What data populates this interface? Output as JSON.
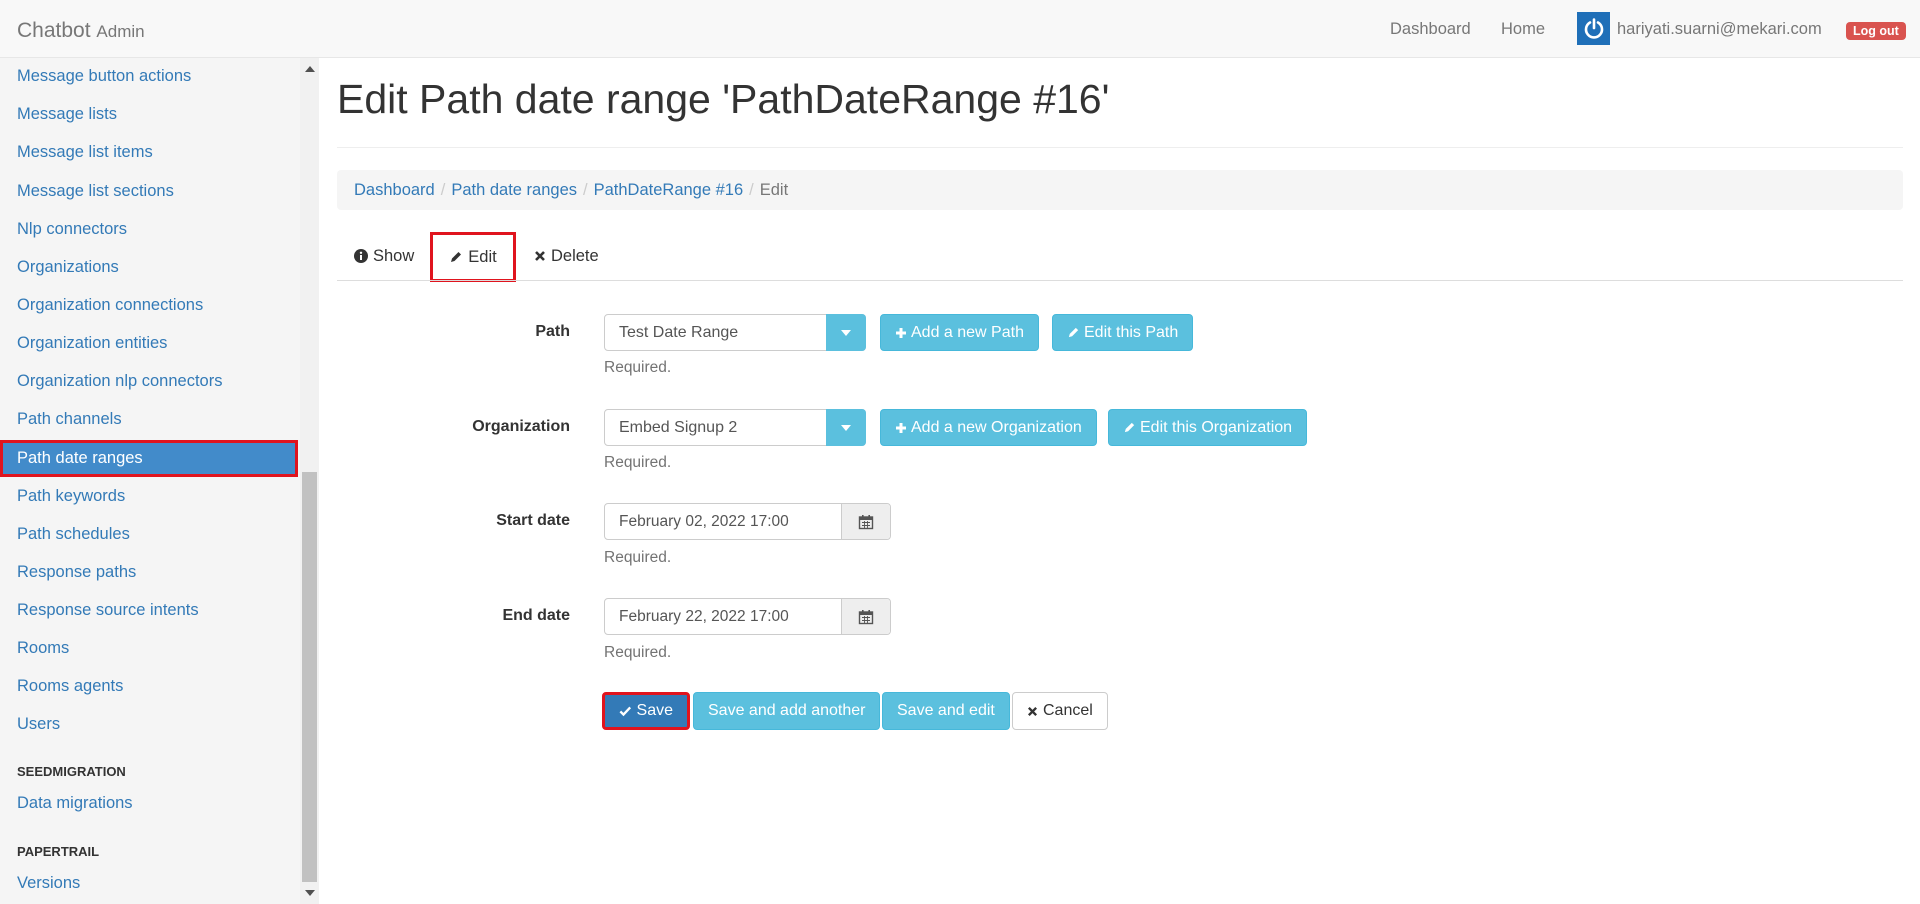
{
  "navbar": {
    "brand": "Chatbot",
    "brand_sub": "Admin",
    "links": [
      "Dashboard",
      "Home"
    ],
    "user_email": "hariyati.suarni@mekari.com",
    "logout_label": "Log out"
  },
  "sidebar": {
    "items": [
      "Message button actions",
      "Message lists",
      "Message list items",
      "Message list sections",
      "Nlp connectors",
      "Organizations",
      "Organization connections",
      "Organization entities",
      "Organization nlp connectors",
      "Path channels",
      "Path date ranges",
      "Path keywords",
      "Path schedules",
      "Response paths",
      "Response source intents",
      "Rooms",
      "Rooms agents",
      "Users"
    ],
    "active_item": "Path date ranges",
    "sections": [
      {
        "header": "SEEDMIGRATION",
        "items": [
          "Data migrations"
        ]
      },
      {
        "header": "PAPERTRAIL",
        "items": [
          "Versions"
        ]
      }
    ]
  },
  "page": {
    "title": "Edit Path date range 'PathDateRange #16'",
    "breadcrumb": [
      "Dashboard",
      "Path date ranges",
      "PathDateRange #16",
      "Edit"
    ],
    "tabs": {
      "show": "Show",
      "edit": "Edit",
      "delete": "Delete"
    }
  },
  "form": {
    "path": {
      "label": "Path",
      "value": "Test Date Range",
      "help": "Required.",
      "add_label": "Add a new Path",
      "edit_label": "Edit this Path"
    },
    "organization": {
      "label": "Organization",
      "value": "Embed Signup 2",
      "help": "Required.",
      "add_label": "Add a new Organization",
      "edit_label": "Edit this Organization"
    },
    "start_date": {
      "label": "Start date",
      "value": "February 02, 2022 17:00",
      "help": "Required."
    },
    "end_date": {
      "label": "End date",
      "value": "February 22, 2022 17:00",
      "help": "Required."
    },
    "buttons": {
      "save": "Save",
      "save_add": "Save and add another",
      "save_edit": "Save and edit",
      "cancel": "Cancel"
    }
  },
  "colors": {
    "primary": "#337ab7",
    "info": "#5bc0de",
    "danger": "#d9534f",
    "highlight": "#e0141e",
    "active_sidebar": "#428bca"
  }
}
